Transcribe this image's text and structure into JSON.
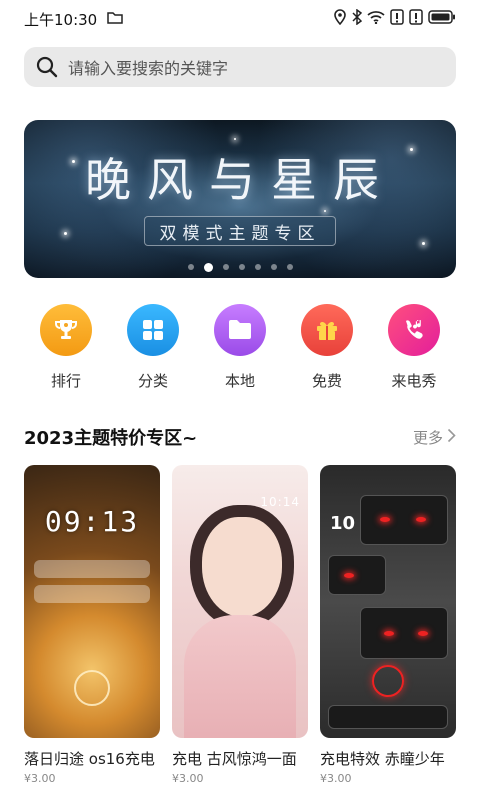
{
  "status_bar": {
    "time": "上午10:30",
    "icons": [
      "folder-icon",
      "location-icon",
      "bluetooth-icon",
      "wifi-icon",
      "alert-icon",
      "alert-icon",
      "battery-icon"
    ]
  },
  "search": {
    "placeholder": "请输入要搜索的关键字"
  },
  "banner": {
    "title": "晚风与星辰",
    "subtitle": "双模式主题专区",
    "dot_count": 7,
    "active_dot": 1
  },
  "categories": [
    {
      "label": "排行",
      "icon": "trophy-icon",
      "color": "#f6a623"
    },
    {
      "label": "分类",
      "icon": "grid-icon",
      "color": "#2aa5f0"
    },
    {
      "label": "本地",
      "icon": "folder-icon",
      "color": "#b562f0"
    },
    {
      "label": "免费",
      "icon": "gift-icon",
      "color": "#f2544b"
    },
    {
      "label": "来电秀",
      "icon": "phone-music-icon",
      "color": "#ff3d8b"
    }
  ],
  "section": {
    "title": "2023主题特价专区~",
    "more": "更多"
  },
  "themes": [
    {
      "name": "落日归途 os16充电",
      "price": "¥3.00",
      "clock": "09:13"
    },
    {
      "name": "充电 古风惊鸿一面",
      "price": "¥3.00",
      "clock": "10:14"
    },
    {
      "name": "充电特效 赤瞳少年",
      "price": "¥3.00",
      "clock": "10"
    }
  ]
}
